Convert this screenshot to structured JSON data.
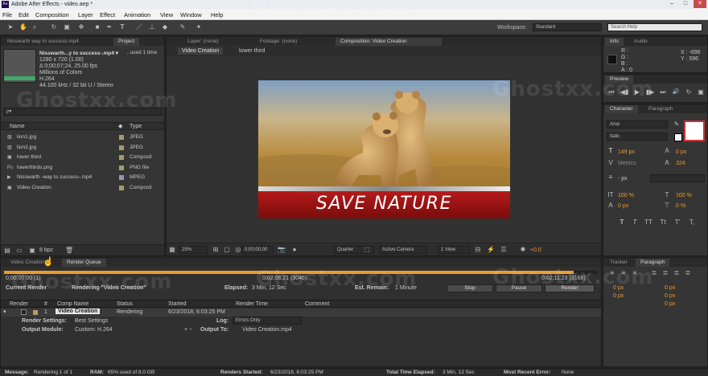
{
  "window": {
    "title": "Adobe After Effects - video.aep *",
    "app_badge": "Ae",
    "controls": [
      "–",
      "□",
      "✕"
    ]
  },
  "menu": [
    "File",
    "Edit",
    "Composition",
    "Layer",
    "Effect",
    "Animation",
    "View",
    "Window",
    "Help"
  ],
  "toolbar": {
    "workspace_label": "Workspace:",
    "workspace_value": "Standard",
    "search_placeholder": "Search Help"
  },
  "project_panel": {
    "tabs": [
      "Nisswarth  way to success.mp4",
      "Project"
    ],
    "file_name": "Nisswarth...y to success-.mp4 ▾",
    "used": ", used 1 time",
    "info": [
      "1280 x 720 (1.00)",
      "Δ 0;00;07;24, 25.00 fps",
      "Millions of Colors",
      "H.264",
      "44.100 kHz / 32 bit U / Stereo"
    ],
    "search_placeholder": "ρ▾",
    "columns": {
      "name": "Name",
      "type": "Type"
    },
    "items": [
      {
        "name": "lion1.jpg",
        "type": "JPEG",
        "icon": "image-icon",
        "color": "#a89a6a"
      },
      {
        "name": "lion2.jpg",
        "type": "JPEG",
        "icon": "image-icon",
        "color": "#a89a6a"
      },
      {
        "name": "lower third",
        "type": "Composit",
        "icon": "composition-icon",
        "color": "#a89a6a"
      },
      {
        "name": "lowerthirds.png",
        "type": "PNG file",
        "icon": "photoshop-file-icon",
        "color": "#a89a6a"
      },
      {
        "name": "Nisswarth -way to success-.mp4",
        "type": "MPEG",
        "icon": "video-file-icon",
        "color": "#9b8fb8"
      },
      {
        "name": "Video Creation",
        "type": "Composit",
        "icon": "composition-icon",
        "color": "#a89a6a"
      }
    ],
    "bpc": "8 bpc"
  },
  "viewer": {
    "tabs": [
      "Layer: (none)",
      "Footage: (none)",
      "Composition: Video Creation"
    ],
    "breadcrumbs": [
      "Video Creation",
      "lower third"
    ],
    "lower_third_text": "SAVE NATURE",
    "zoom": "25%",
    "timecode": "0;00;00;00",
    "resolution": "Quarter",
    "camera": "Active Camera",
    "views": "1 View",
    "exposure": "+0.0"
  },
  "info_panel": {
    "tabs": [
      "Info",
      "Audio"
    ],
    "rgb": [
      "R :",
      "G :",
      "B :",
      "A : 0"
    ],
    "x": "X : -696",
    "y": "Y : 596"
  },
  "preview_panel": {
    "tab": "Preview",
    "controls": [
      "⏮",
      "◀▮",
      "▶",
      "▮▶",
      "⏭",
      "🔊",
      "↻",
      "▣"
    ]
  },
  "character_panel": {
    "tabs": [
      "Character",
      "Paragraph"
    ],
    "font": "Arial",
    "style": "Italic",
    "size": "149 px",
    "leading": "0 px",
    "tracking_label": "Metrics",
    "tracking": "324",
    "stroke": "- px",
    "vscale": "100 %",
    "hscale": "100 %",
    "baseline": "0 px",
    "tsume": "0 %",
    "styles": [
      "T",
      "T",
      "TT",
      "Tt",
      "T'",
      "T,"
    ]
  },
  "render_panel": {
    "tabs": [
      "Video Creation",
      "Render Queue"
    ],
    "elapsed_left": "0;00;00;00 (1)",
    "elapsed_mid": "0;02;06;21 (3046)",
    "elapsed_right": "0;02;11;23 (3168)",
    "current_render": "Current Render",
    "rendering": "Rendering \"Video Creation\"",
    "elapsed_label": "Elapsed:",
    "elapsed": "3 Min, 12 Sec",
    "remain_label": "Est. Remain:",
    "remain": "1 Minute",
    "stop": "Stop",
    "pause": "Pause",
    "render": "Render",
    "columns": [
      "Render",
      "#",
      "Comp Name",
      "Status",
      "Started",
      "Render Time",
      "Comment"
    ],
    "item": {
      "num": "1",
      "comp": "Video Creation",
      "status": "Rendering",
      "started": "6/23/2018, 6:03:25 PM"
    },
    "settings_label": "Render Settings:",
    "settings": "Best Settings",
    "log_label": "Log:",
    "log": "Errors Only",
    "module_label": "Output Module:",
    "module": "Custom: H.264",
    "output_label": "Output To:",
    "output": "Video Creation.mp4",
    "progress": 0.96
  },
  "tracker_panel": {
    "tabs": [
      "Tracker",
      "Paragraph"
    ],
    "indent": [
      "0 px",
      "0 px",
      "0 px",
      "0 px",
      "0 px"
    ]
  },
  "statusbar": {
    "message": "Message:",
    "message_v": "Rendering 1 of 1",
    "ram": "RAM:",
    "ram_v": "65% used of 8.0 GB",
    "started": "Renders Started:",
    "started_v": "6/23/2018, 6:03:25 PM",
    "total": "Total Time Elapsed:",
    "total_v": "3 Min, 13 Sec",
    "error": "Most Recent Error:",
    "error_v": "None"
  },
  "watermark": "Ghostxx.com"
}
